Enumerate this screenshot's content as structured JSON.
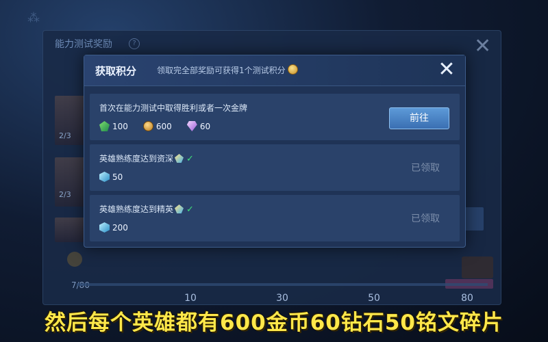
{
  "background": {
    "title": "能力测试奖励",
    "help": "?",
    "close": "✕",
    "side_counts": [
      "2/3",
      "2/3"
    ],
    "total_count": "7/80",
    "milestones": [
      "10",
      "30",
      "50",
      "80"
    ]
  },
  "dialog": {
    "title": "获取积分",
    "hint": "领取完全部奖励可获得1个测试积分",
    "close": "✕",
    "tasks": [
      {
        "title": "首次在能力测试中取得胜利或者一次金牌",
        "rewards": [
          {
            "icon": "gem-green-icon",
            "value": "100"
          },
          {
            "icon": "coin-icon",
            "value": "600"
          },
          {
            "icon": "diamond-icon",
            "value": "60"
          }
        ],
        "action": "前往"
      },
      {
        "title": "英雄熟练度达到资深",
        "rewards": [
          {
            "icon": "shard-icon",
            "value": "50"
          }
        ],
        "status": "已领取"
      },
      {
        "title": "英雄熟练度达到精英",
        "rewards": [
          {
            "icon": "shard-icon",
            "value": "200"
          }
        ],
        "status": "已领取"
      }
    ]
  },
  "subtitle": "然后每个英雄都有600金币60钻石50铭文碎片"
}
